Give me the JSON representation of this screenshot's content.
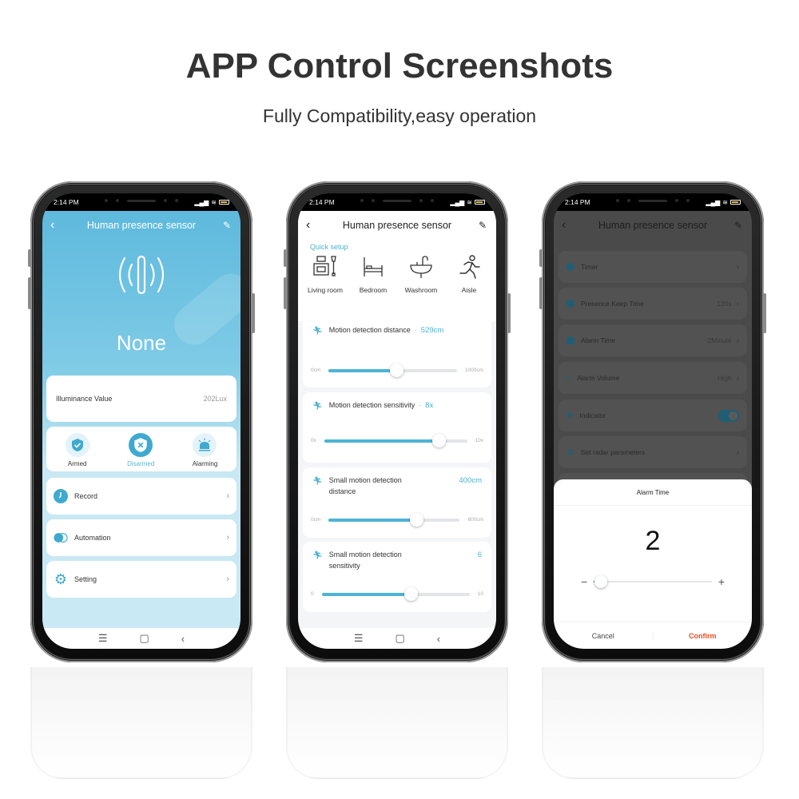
{
  "header": {
    "title": "APP Control Screenshots",
    "subtitle": "Fully Compatibility,easy operation"
  },
  "phones": [
    {
      "status_time": "2:14 PM",
      "app_title": "Human presence sensor",
      "icons": {
        "back": "chevron-left-icon",
        "edit": "edit-pencil-icon",
        "radar": "radar-presence-icon"
      },
      "presence_state": "None",
      "illuminance": {
        "label": "Illuminance Value",
        "value": "202Lux"
      },
      "modes": [
        {
          "label": "Armed",
          "icon": "shield-check-icon",
          "active": false
        },
        {
          "label": "Disarmed",
          "icon": "shield-x-icon",
          "active": true
        },
        {
          "label": "Alarming",
          "icon": "siren-icon",
          "active": false
        }
      ],
      "menu": [
        {
          "label": "Record",
          "icon": "clock-icon"
        },
        {
          "label": "Automation",
          "icon": "toggle-circles-icon"
        },
        {
          "label": "Setting",
          "icon": "gear-icon"
        }
      ],
      "accent": "#3fa9cf"
    },
    {
      "status_time": "2:14 PM",
      "app_title": "Human presence sensor",
      "quick_setup_label": "Quick setup",
      "scenes": [
        {
          "label": "Living room",
          "icon": "living-room-icon"
        },
        {
          "label": "Bedroom",
          "icon": "bed-icon"
        },
        {
          "label": "Washroom",
          "icon": "sink-icon"
        },
        {
          "label": "Aisle",
          "icon": "running-person-icon"
        }
      ],
      "sliders": [
        {
          "label": "Motion detection distance",
          "value": "529cm",
          "min_label": "0cm",
          "max_label": "1000cm",
          "min": 0,
          "max": 1000,
          "current": 529
        },
        {
          "label": "Motion detection sensitivity",
          "value": "8x",
          "min_label": "0x",
          "max_label": "10x",
          "min": 0,
          "max": 10,
          "current": 8
        },
        {
          "label": "Small motion  detection distance",
          "value": "400cm",
          "min_label": "0cm",
          "max_label": "600cm",
          "min": 0,
          "max": 600,
          "current": 400
        },
        {
          "label": "Small motion detection sensitivity",
          "value": "6",
          "min_label": "0",
          "max_label": "10",
          "min": 0,
          "max": 10,
          "current": 6
        }
      ],
      "accent": "#4db3d6"
    },
    {
      "status_time": "2:14 PM",
      "app_title": "Human presence sensor",
      "settings": [
        {
          "label": "Timer",
          "value": "",
          "icon": "clock-icon"
        },
        {
          "label": "Presence Keep Time",
          "value": "120s",
          "icon": "clock-icon"
        },
        {
          "label": "Alarm Time",
          "value": "2Minute",
          "icon": "siren-icon"
        },
        {
          "label": "Alarm Volume",
          "value": "High",
          "icon": "speaker-icon"
        },
        {
          "label": "Indicator",
          "value": "",
          "icon": "light-icon",
          "toggle": true
        },
        {
          "label": "Set radar parameters",
          "value": "",
          "icon": "gear-icon"
        }
      ],
      "dialog": {
        "title": "Alarm Time",
        "value": "2",
        "minus": "−",
        "plus": "+",
        "slider_fraction": 0.03,
        "cancel": "Cancel",
        "confirm": "Confirm",
        "confirm_color": "#e8501e"
      }
    }
  ],
  "nav": {
    "menu": "☰",
    "home": "▢",
    "back": "‹"
  }
}
